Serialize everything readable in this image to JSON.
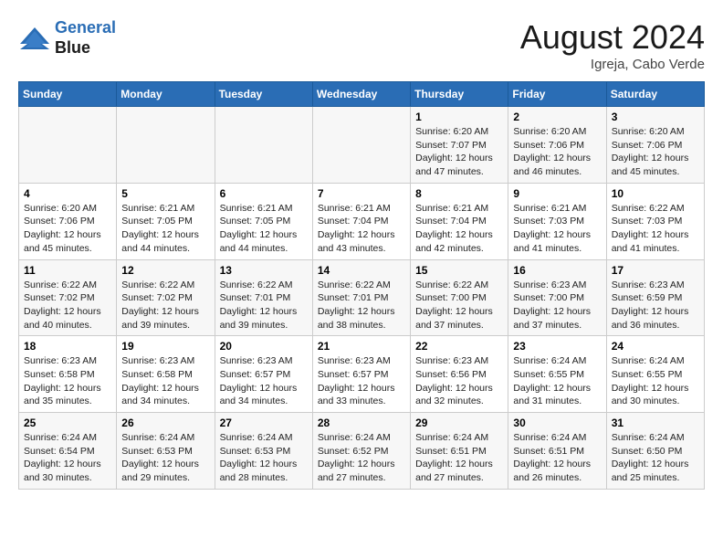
{
  "header": {
    "logo_line1": "General",
    "logo_line2": "Blue",
    "month_title": "August 2024",
    "subtitle": "Igreja, Cabo Verde"
  },
  "days_of_week": [
    "Sunday",
    "Monday",
    "Tuesday",
    "Wednesday",
    "Thursday",
    "Friday",
    "Saturday"
  ],
  "weeks": [
    [
      {
        "day": "",
        "info": ""
      },
      {
        "day": "",
        "info": ""
      },
      {
        "day": "",
        "info": ""
      },
      {
        "day": "",
        "info": ""
      },
      {
        "day": "1",
        "info": "Sunrise: 6:20 AM\nSunset: 7:07 PM\nDaylight: 12 hours and 47 minutes."
      },
      {
        "day": "2",
        "info": "Sunrise: 6:20 AM\nSunset: 7:06 PM\nDaylight: 12 hours and 46 minutes."
      },
      {
        "day": "3",
        "info": "Sunrise: 6:20 AM\nSunset: 7:06 PM\nDaylight: 12 hours and 45 minutes."
      }
    ],
    [
      {
        "day": "4",
        "info": "Sunrise: 6:20 AM\nSunset: 7:06 PM\nDaylight: 12 hours and 45 minutes."
      },
      {
        "day": "5",
        "info": "Sunrise: 6:21 AM\nSunset: 7:05 PM\nDaylight: 12 hours and 44 minutes."
      },
      {
        "day": "6",
        "info": "Sunrise: 6:21 AM\nSunset: 7:05 PM\nDaylight: 12 hours and 44 minutes."
      },
      {
        "day": "7",
        "info": "Sunrise: 6:21 AM\nSunset: 7:04 PM\nDaylight: 12 hours and 43 minutes."
      },
      {
        "day": "8",
        "info": "Sunrise: 6:21 AM\nSunset: 7:04 PM\nDaylight: 12 hours and 42 minutes."
      },
      {
        "day": "9",
        "info": "Sunrise: 6:21 AM\nSunset: 7:03 PM\nDaylight: 12 hours and 41 minutes."
      },
      {
        "day": "10",
        "info": "Sunrise: 6:22 AM\nSunset: 7:03 PM\nDaylight: 12 hours and 41 minutes."
      }
    ],
    [
      {
        "day": "11",
        "info": "Sunrise: 6:22 AM\nSunset: 7:02 PM\nDaylight: 12 hours and 40 minutes."
      },
      {
        "day": "12",
        "info": "Sunrise: 6:22 AM\nSunset: 7:02 PM\nDaylight: 12 hours and 39 minutes."
      },
      {
        "day": "13",
        "info": "Sunrise: 6:22 AM\nSunset: 7:01 PM\nDaylight: 12 hours and 39 minutes."
      },
      {
        "day": "14",
        "info": "Sunrise: 6:22 AM\nSunset: 7:01 PM\nDaylight: 12 hours and 38 minutes."
      },
      {
        "day": "15",
        "info": "Sunrise: 6:22 AM\nSunset: 7:00 PM\nDaylight: 12 hours and 37 minutes."
      },
      {
        "day": "16",
        "info": "Sunrise: 6:23 AM\nSunset: 7:00 PM\nDaylight: 12 hours and 37 minutes."
      },
      {
        "day": "17",
        "info": "Sunrise: 6:23 AM\nSunset: 6:59 PM\nDaylight: 12 hours and 36 minutes."
      }
    ],
    [
      {
        "day": "18",
        "info": "Sunrise: 6:23 AM\nSunset: 6:58 PM\nDaylight: 12 hours and 35 minutes."
      },
      {
        "day": "19",
        "info": "Sunrise: 6:23 AM\nSunset: 6:58 PM\nDaylight: 12 hours and 34 minutes."
      },
      {
        "day": "20",
        "info": "Sunrise: 6:23 AM\nSunset: 6:57 PM\nDaylight: 12 hours and 34 minutes."
      },
      {
        "day": "21",
        "info": "Sunrise: 6:23 AM\nSunset: 6:57 PM\nDaylight: 12 hours and 33 minutes."
      },
      {
        "day": "22",
        "info": "Sunrise: 6:23 AM\nSunset: 6:56 PM\nDaylight: 12 hours and 32 minutes."
      },
      {
        "day": "23",
        "info": "Sunrise: 6:24 AM\nSunset: 6:55 PM\nDaylight: 12 hours and 31 minutes."
      },
      {
        "day": "24",
        "info": "Sunrise: 6:24 AM\nSunset: 6:55 PM\nDaylight: 12 hours and 30 minutes."
      }
    ],
    [
      {
        "day": "25",
        "info": "Sunrise: 6:24 AM\nSunset: 6:54 PM\nDaylight: 12 hours and 30 minutes."
      },
      {
        "day": "26",
        "info": "Sunrise: 6:24 AM\nSunset: 6:53 PM\nDaylight: 12 hours and 29 minutes."
      },
      {
        "day": "27",
        "info": "Sunrise: 6:24 AM\nSunset: 6:53 PM\nDaylight: 12 hours and 28 minutes."
      },
      {
        "day": "28",
        "info": "Sunrise: 6:24 AM\nSunset: 6:52 PM\nDaylight: 12 hours and 27 minutes."
      },
      {
        "day": "29",
        "info": "Sunrise: 6:24 AM\nSunset: 6:51 PM\nDaylight: 12 hours and 27 minutes."
      },
      {
        "day": "30",
        "info": "Sunrise: 6:24 AM\nSunset: 6:51 PM\nDaylight: 12 hours and 26 minutes."
      },
      {
        "day": "31",
        "info": "Sunrise: 6:24 AM\nSunset: 6:50 PM\nDaylight: 12 hours and 25 minutes."
      }
    ]
  ]
}
